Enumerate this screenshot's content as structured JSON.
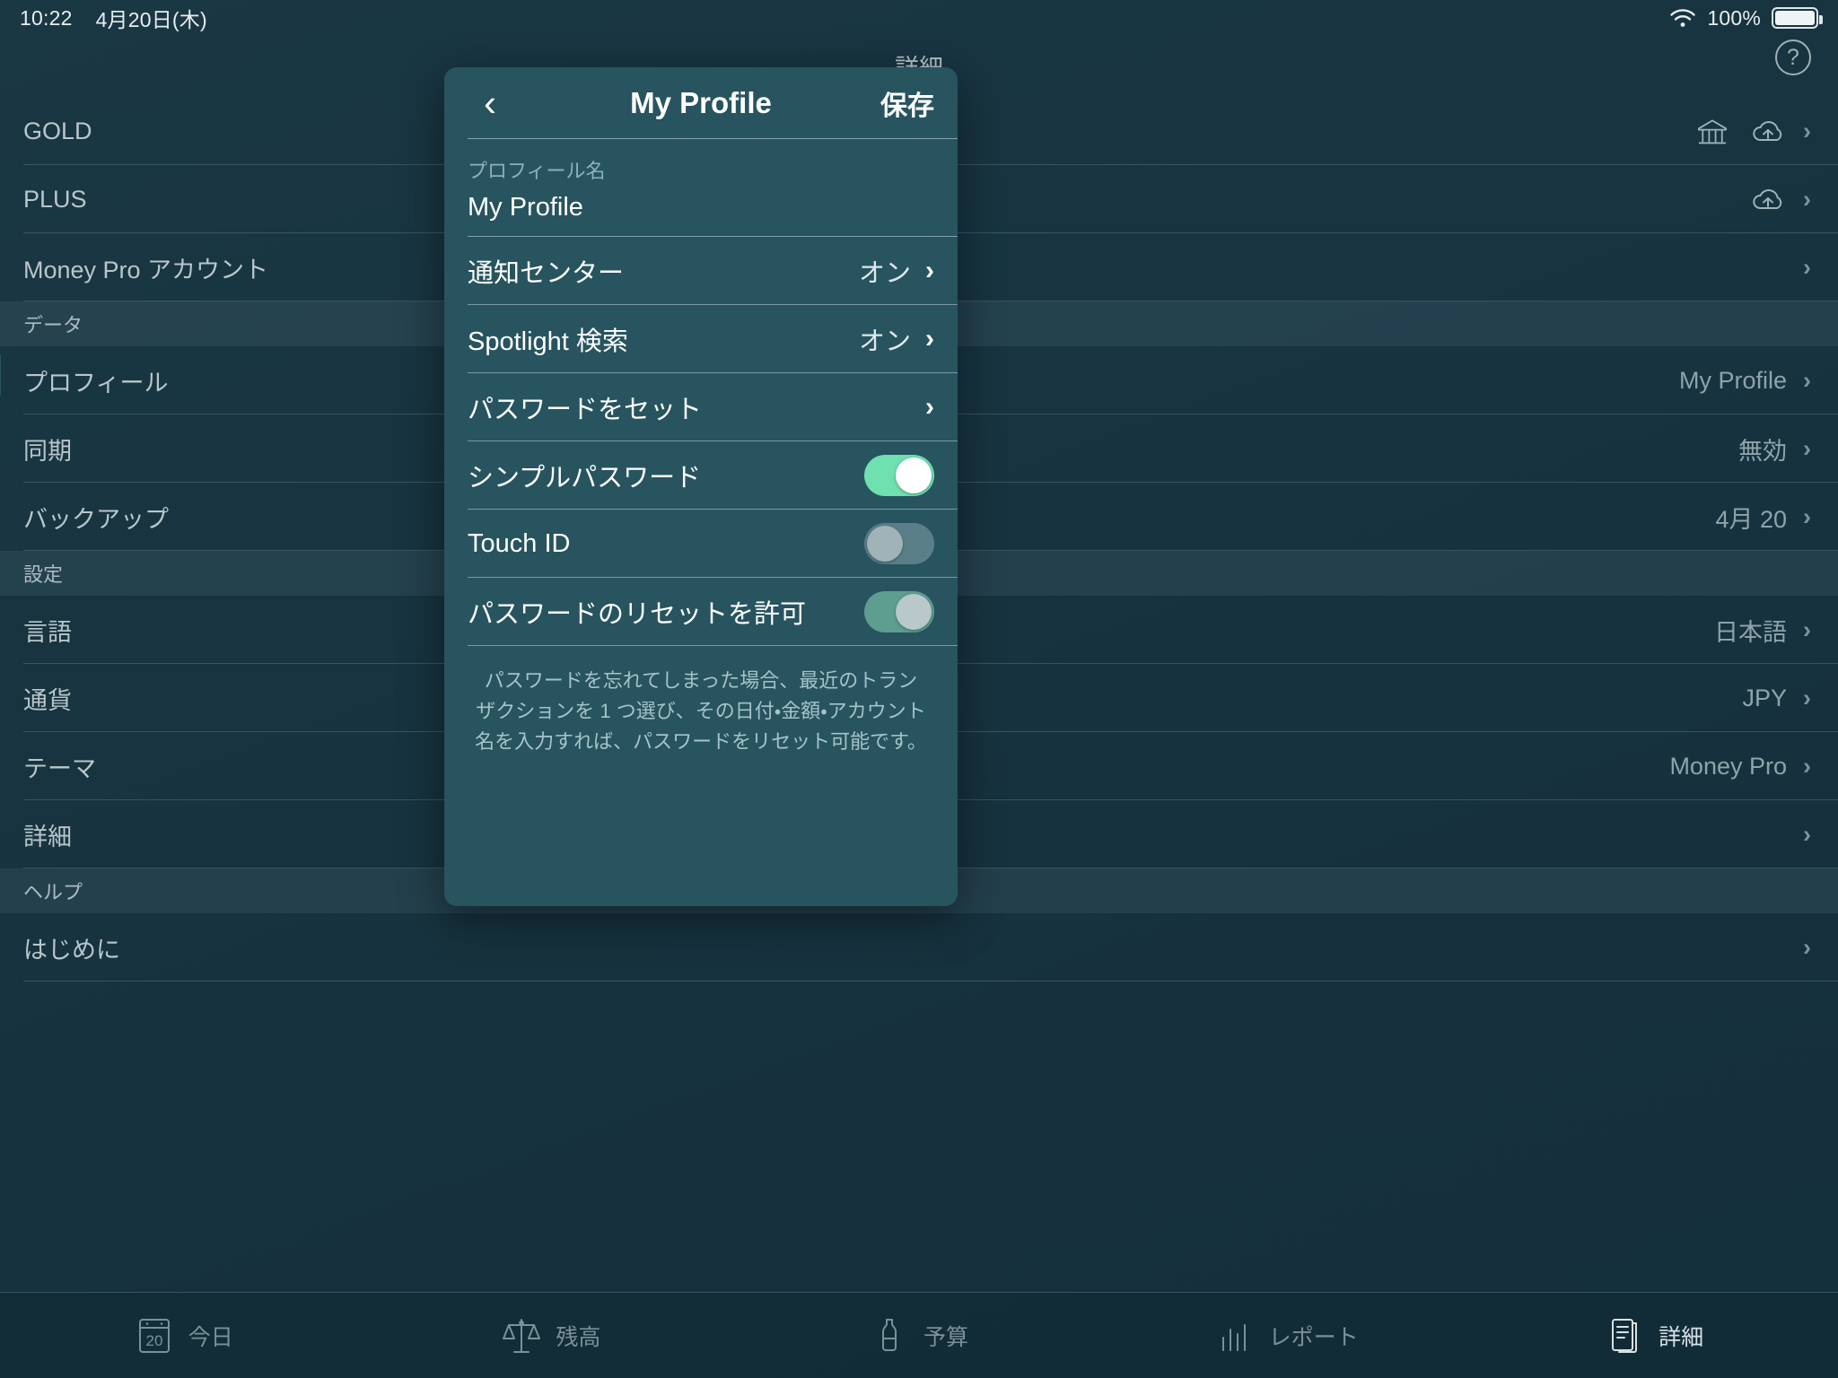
{
  "statusbar": {
    "time": "10:22",
    "date": "4月20日(木)",
    "battery_pct": "100%",
    "wifi_icon": "wifi-icon",
    "battery_icon": "battery-full-icon"
  },
  "navbar": {
    "title": "詳細",
    "help_label": "?"
  },
  "settings_list": [
    {
      "type": "row",
      "label": "GOLD",
      "value": "",
      "icons": [
        "bank-icon",
        "cloud-sync-icon"
      ],
      "chevron": "›"
    },
    {
      "type": "row",
      "label": "PLUS",
      "value": "",
      "icons": [
        "cloud-sync-icon"
      ],
      "chevron": "›"
    },
    {
      "type": "row",
      "label": "Money Pro アカウント",
      "value": "",
      "icons": [],
      "chevron": "›"
    },
    {
      "type": "header",
      "label": "データ"
    },
    {
      "type": "row",
      "label": "プロフィール",
      "value": "My Profile",
      "icons": [],
      "chevron": "›"
    },
    {
      "type": "row",
      "label": "同期",
      "value": "無効",
      "icons": [],
      "chevron": "›"
    },
    {
      "type": "row",
      "label": "バックアップ",
      "value": "4月 20",
      "icons": [],
      "chevron": "›"
    },
    {
      "type": "header",
      "label": "設定"
    },
    {
      "type": "row",
      "label": "言語",
      "value": "日本語",
      "icons": [],
      "chevron": "›"
    },
    {
      "type": "row",
      "label": "通貨",
      "value": "JPY",
      "icons": [],
      "chevron": "›"
    },
    {
      "type": "row",
      "label": "テーマ",
      "value": "Money Pro",
      "icons": [],
      "chevron": "›"
    },
    {
      "type": "row",
      "label": "詳細",
      "value": "",
      "icons": [],
      "chevron": "›"
    },
    {
      "type": "header",
      "label": "ヘルプ"
    },
    {
      "type": "row",
      "label": "はじめに",
      "value": "",
      "icons": [],
      "chevron": "›"
    }
  ],
  "tabbar": {
    "tabs": [
      {
        "label": "今日",
        "icon": "calendar-20-icon",
        "active": false
      },
      {
        "label": "残高",
        "icon": "scales-icon",
        "active": false
      },
      {
        "label": "予算",
        "icon": "bottle-icon",
        "active": false
      },
      {
        "label": "レポート",
        "icon": "bar-chart-icon",
        "active": false
      },
      {
        "label": "詳細",
        "icon": "document-icon",
        "active": true
      }
    ]
  },
  "popover": {
    "back_label": "‹",
    "title": "My Profile",
    "save_label": "保存",
    "name_field": {
      "label": "プロフィール名",
      "value": "My Profile",
      "placeholder": "プロフィール名"
    },
    "rows": [
      {
        "label": "通知センター",
        "kind": "value",
        "value": "オン",
        "chevron": "›"
      },
      {
        "label": "Spotlight 検索",
        "kind": "value",
        "value": "オン",
        "chevron": "›"
      },
      {
        "label": "パスワードをセット",
        "kind": "value",
        "value": "",
        "chevron": "›"
      },
      {
        "label": "シンプルパスワード",
        "kind": "switch",
        "state": "on"
      },
      {
        "label": "Touch ID",
        "kind": "switch",
        "state": "off"
      },
      {
        "label": "パスワードのリセットを許可",
        "kind": "switch",
        "state": "on-dim"
      }
    ],
    "footnote": "パスワードを忘れてしまった場合、最近のトランザクションを 1 つ選び、その日付・金額・アカウント名を入力すれば、パスワードをリセット可能です。"
  },
  "colors": {
    "accent_on": "#6fe0b0",
    "popover_bg": "#27545f",
    "page_bg": "#16313c"
  }
}
